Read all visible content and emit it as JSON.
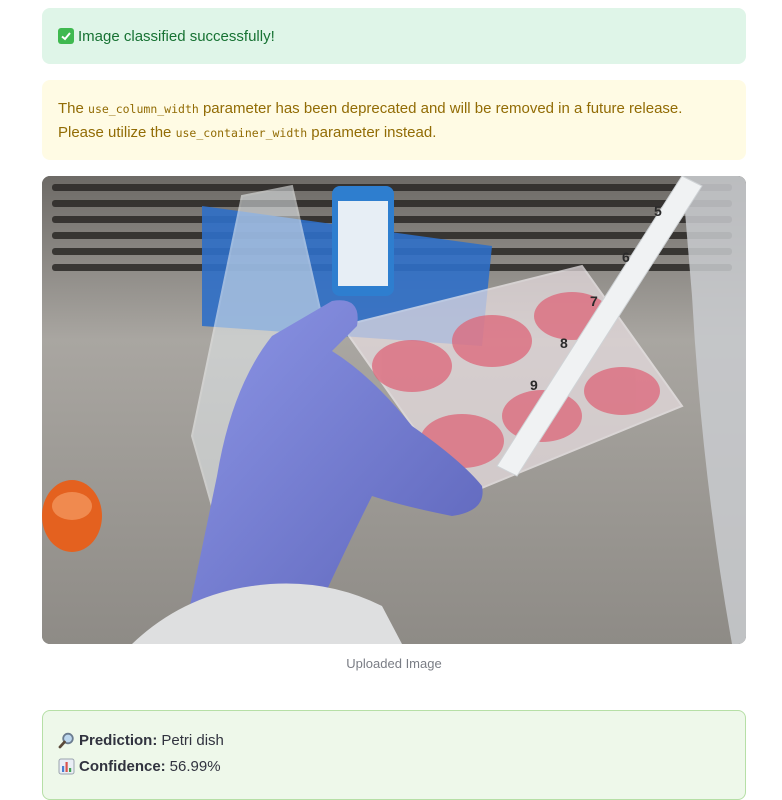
{
  "success_alert": {
    "icon": "check-mark-icon",
    "text": "Image classified successfully!"
  },
  "warning_alert": {
    "text_1": "The ",
    "code_1": "use_column_width",
    "text_2": " parameter has been deprecated and will be removed in a future release. Please utilize the ",
    "code_2": "use_container_width",
    "text_3": " parameter instead."
  },
  "image": {
    "caption": "Uploaded Image",
    "pipette_marks": [
      "5",
      "6",
      "7",
      "8",
      "9"
    ]
  },
  "result": {
    "prediction_icon": "magnifying-glass-icon",
    "prediction_label": "Prediction:",
    "prediction_value": "Petri dish",
    "confidence_icon": "bar-chart-icon",
    "confidence_label": "Confidence:",
    "confidence_value": "56.99%"
  },
  "colors": {
    "success_bg": "#dff5e8",
    "success_text": "#177233",
    "warning_bg": "#fffbe4",
    "warning_text": "#926c05",
    "result_bg": "#eef8ea",
    "result_border": "#b6dfa6"
  }
}
